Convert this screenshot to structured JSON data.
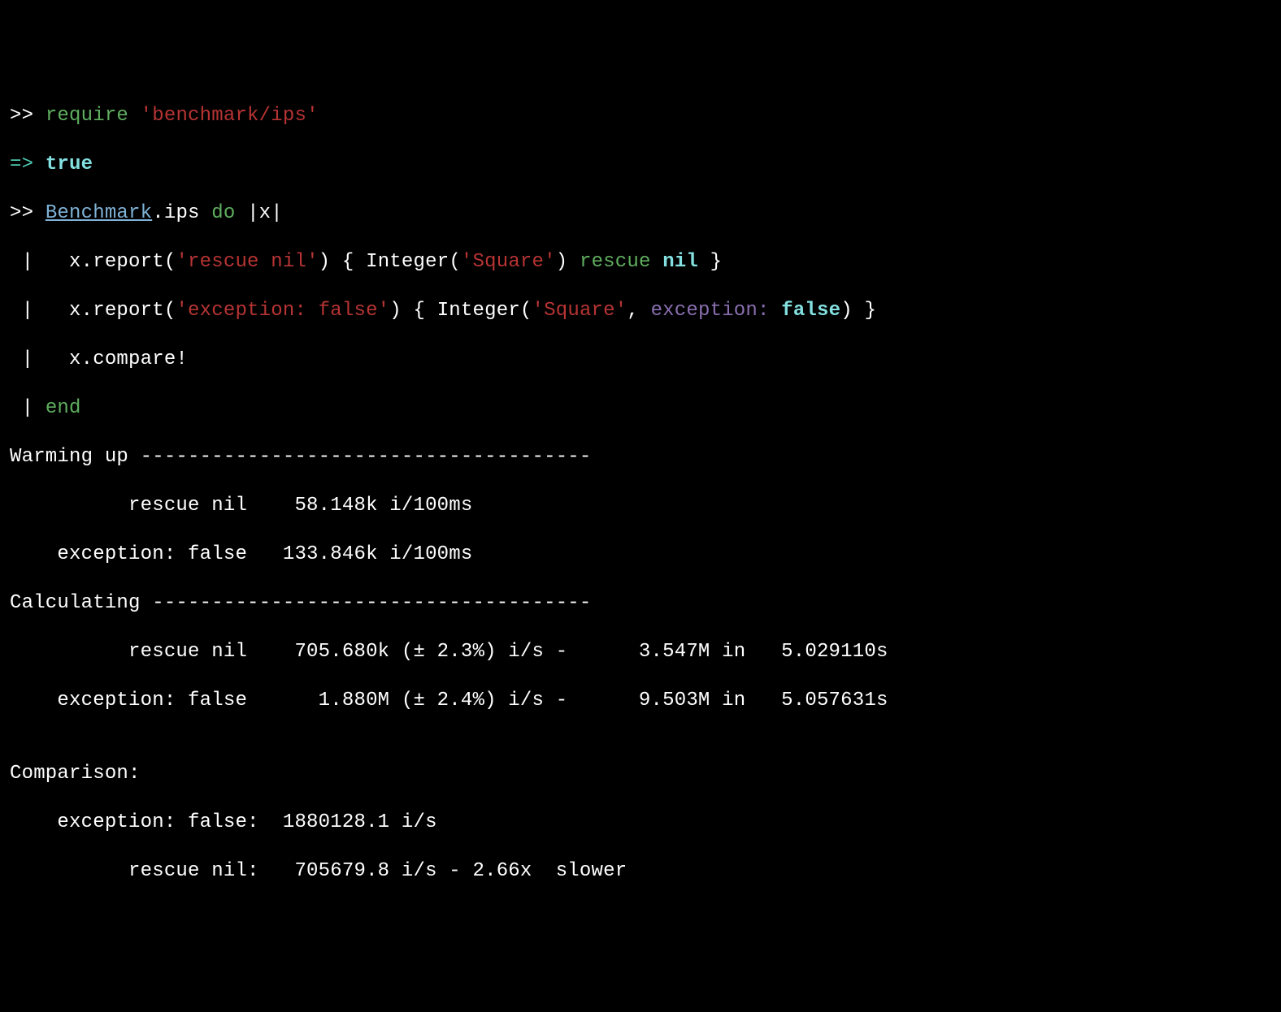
{
  "l1": {
    "prompt": ">> ",
    "require": "require",
    "sp": " ",
    "str": "'benchmark/ips'"
  },
  "l2": {
    "fat": "=> ",
    "true": "true"
  },
  "l3": {
    "prompt": ">> ",
    "const": "Benchmark",
    "dot_ips": ".ips ",
    "do": "do",
    "pipes": " |x|"
  },
  "l4": {
    "bar": " |   ",
    "lead": "x.report(",
    "str1": "'rescue nil'",
    "mid1": ") { ",
    "int": "Integer",
    "paren": "(",
    "str2": "'Square'",
    "close": ") ",
    "rescue": "rescue",
    "sp2": " ",
    "nil": "nil",
    "brace": " }"
  },
  "l5": {
    "bar": " |   ",
    "lead": "x.report(",
    "str1": "'exception: false'",
    "mid1": ") { ",
    "int": "Integer",
    "paren": "(",
    "str2": "'Square'",
    "comma": ", ",
    "sym": "exception:",
    "sp": " ",
    "false": "false",
    "close": ") }"
  },
  "l6": {
    "bar": " |   ",
    "text": "x.compare!"
  },
  "l7": {
    "bar": " | ",
    "end": "end"
  },
  "out": {
    "warm_hdr": "Warming up --------------------------------------",
    "warm_1": "          rescue nil    58.148k i/100ms",
    "warm_2": "    exception: false   133.846k i/100ms",
    "calc_hdr": "Calculating -------------------------------------",
    "calc_1": "          rescue nil    705.680k (± 2.3%) i/s -      3.547M in   5.029110s",
    "calc_2": "    exception: false      1.880M (± 2.4%) i/s -      9.503M in   5.057631s",
    "blank": "",
    "cmp_hdr": "Comparison:",
    "cmp_1": "    exception: false:  1880128.1 i/s",
    "cmp_2": "          rescue nil:   705679.8 i/s - 2.66x  slower"
  }
}
